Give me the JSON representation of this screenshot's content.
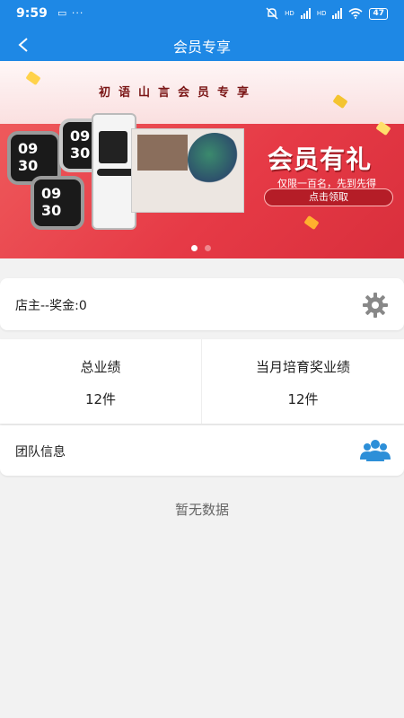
{
  "status_bar": {
    "time": "9:59",
    "left_icons": "▭ ···",
    "network_label_1": "HD",
    "network_label_2": "HD",
    "battery": "47"
  },
  "header": {
    "title": "会员专享"
  },
  "banner": {
    "slogan": "初语山言会员专享",
    "headline": "会员有礼",
    "subline": "仅限一百名，先到先得",
    "cta_label": "点击领取",
    "watch_time_1": "09 30",
    "watch_time_2": "09 30",
    "watch_time_3": "09 30",
    "carousel_page": 1,
    "carousel_total": 2
  },
  "shop": {
    "label": "店主--奖金:0"
  },
  "stats": [
    {
      "title": "总业绩",
      "value": "12件"
    },
    {
      "title": "当月培育奖业绩",
      "value": "12件"
    }
  ],
  "team": {
    "label": "团队信息"
  },
  "empty_state": "暂无数据",
  "colors": {
    "primary": "#1e88e5",
    "banner_red": "#e63a46",
    "icon_blue": "#2d8fd8",
    "gear_gray": "#888888"
  }
}
